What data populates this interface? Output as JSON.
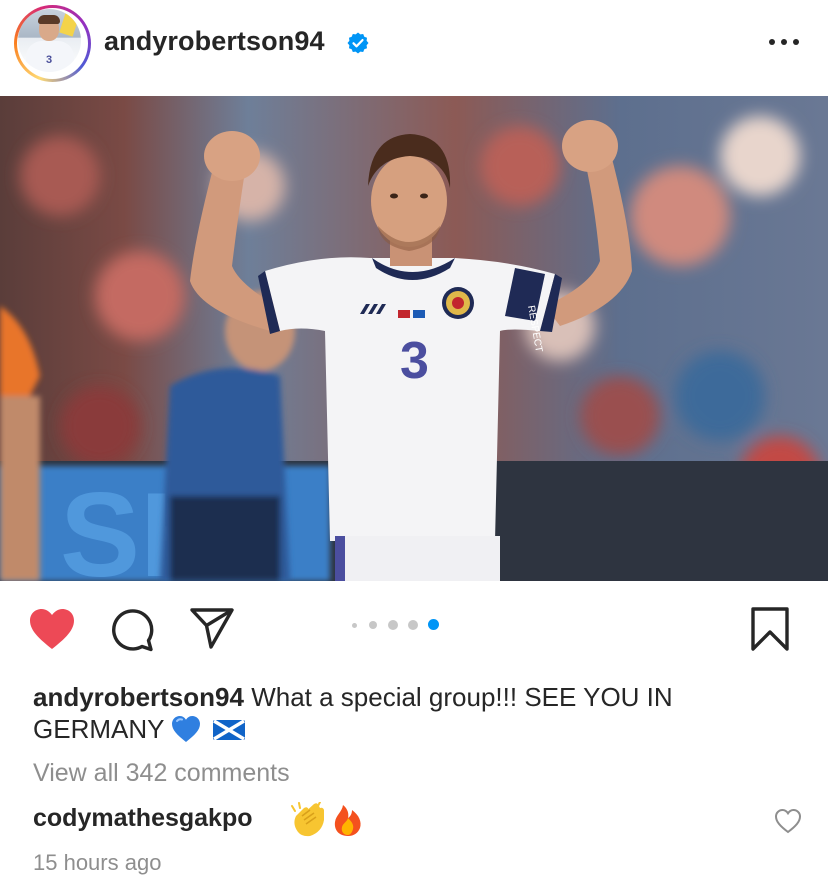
{
  "post": {
    "username": "andyrobertson94",
    "verified": true,
    "avatar_jersey_number": "3",
    "photo": {
      "subject": "player-celebrating",
      "jersey_number": "3",
      "armband_text": "RESPECT"
    },
    "carousel": {
      "total_dots": 5,
      "active_index": 4
    },
    "liked": true,
    "caption": {
      "author": "andyrobertson94",
      "text": "What a special group!!! SEE YOU IN GERMANY",
      "emojis": [
        "blue-heart",
        "scotland-flag"
      ]
    },
    "view_comments_label": "View all 342 comments",
    "top_comment": {
      "author": "codymathesgakpo",
      "emojis": [
        "clapping-hands",
        "fire"
      ]
    },
    "timestamp": "15 hours ago"
  },
  "colors": {
    "like_red": "#ed4956",
    "verified_blue": "#0095f6",
    "active_dot": "#0095f6",
    "muted_text": "#8e8e8e",
    "text": "#262626"
  },
  "icons": [
    "more-icon",
    "verified-badge-icon",
    "heart-icon",
    "comment-icon",
    "share-icon",
    "bookmark-icon",
    "comment-like-icon"
  ]
}
